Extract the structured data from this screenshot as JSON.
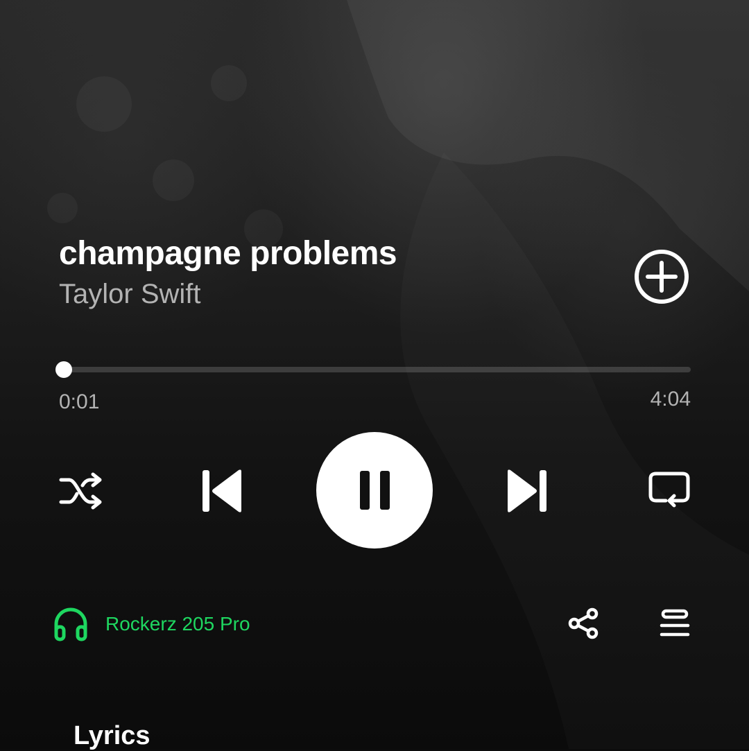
{
  "track": {
    "title": "champagne problems",
    "artist": "Taylor Swift"
  },
  "playback": {
    "elapsed": "0:01",
    "total": "4:04",
    "progress_fraction": 0.004,
    "state": "playing"
  },
  "controls": {
    "shuffle_icon": "shuffle-icon",
    "previous_icon": "skip-previous-icon",
    "play_pause_icon": "pause-icon",
    "next_icon": "skip-next-icon",
    "repeat_icon": "repeat-icon",
    "add_icon": "plus-circle-icon"
  },
  "device": {
    "name": "Rockerz 205 Pro",
    "icon": "headphones-icon"
  },
  "actions": {
    "share_icon": "share-icon",
    "queue_icon": "queue-icon"
  },
  "lyrics": {
    "heading": "Lyrics"
  },
  "colors": {
    "accent": "#1ed760",
    "text_primary": "#ffffff",
    "text_secondary": "#b3b3b3"
  }
}
